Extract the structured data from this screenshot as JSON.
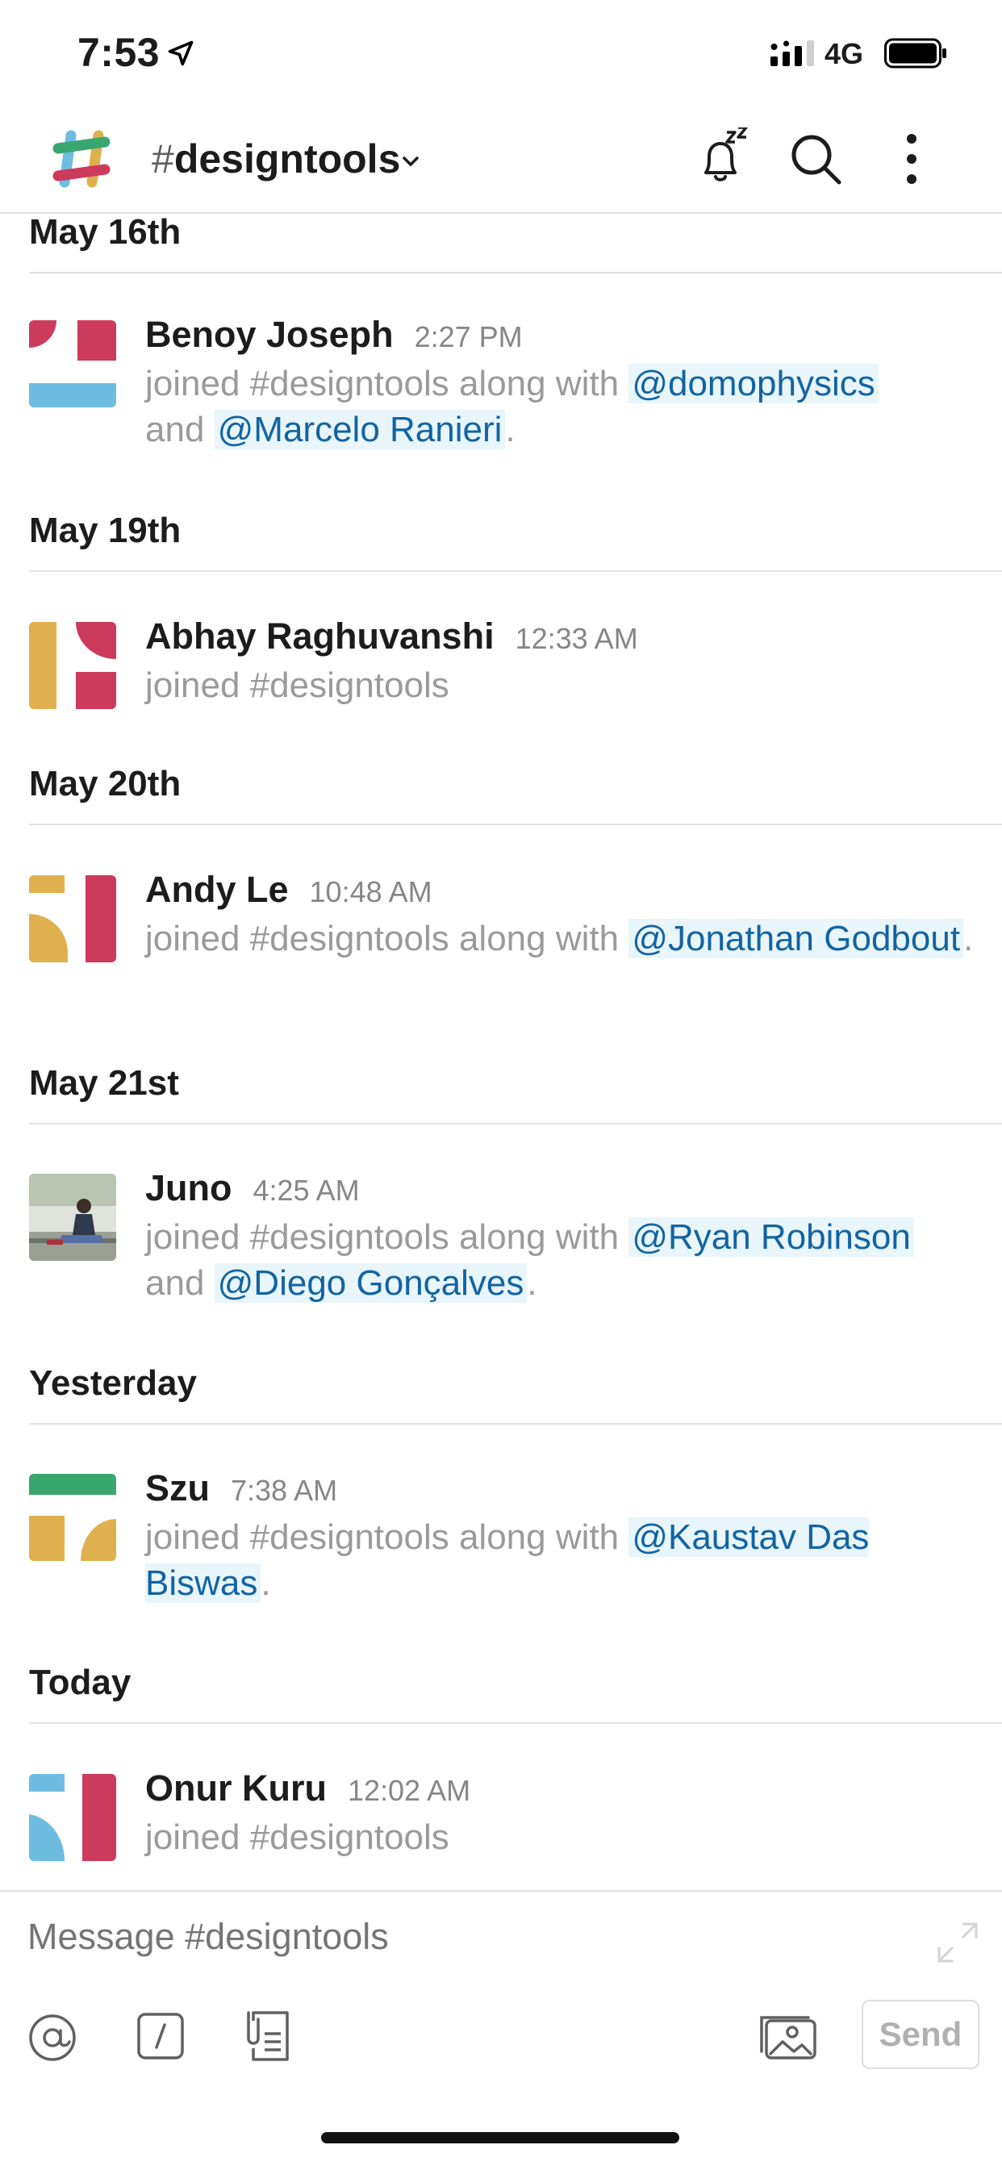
{
  "status_bar": {
    "time": "7:53",
    "network": "4G"
  },
  "header": {
    "hash": "#",
    "channel": "designtools"
  },
  "days": [
    {
      "label": "May 16th",
      "messages": [
        {
          "author": "Benoy Joseph",
          "time": "2:27 PM",
          "text_1": "joined #designtools along with ",
          "mention_1": "@domophysics",
          "text_2": "and ",
          "mention_2": "@Marcelo Ranieri",
          "text_3": "."
        }
      ]
    },
    {
      "label": "May 19th",
      "messages": [
        {
          "author": "Abhay Raghuvanshi",
          "time": "12:33 AM",
          "text_1": "joined #designtools"
        }
      ]
    },
    {
      "label": "May 20th",
      "messages": [
        {
          "author": "Andy Le",
          "time": "10:48 AM",
          "text_1": "joined #designtools along with ",
          "mention_1": "@Jonathan Godbout",
          "text_2": "."
        }
      ]
    },
    {
      "label": "May 21st",
      "messages": [
        {
          "author": "Juno",
          "time": "4:25 AM",
          "text_1": "joined #designtools along with ",
          "mention_1": "@Ryan Robinson",
          "text_2": "and ",
          "mention_2": "@Diego Gonçalves",
          "text_3": "."
        }
      ]
    },
    {
      "label": "Yesterday",
      "messages": [
        {
          "author": "Szu",
          "time": "7:38 AM",
          "text_1": "joined #designtools along with ",
          "mention_1": "@Kaustav Das Biswas",
          "text_2": "."
        }
      ]
    },
    {
      "label": "Today",
      "messages": [
        {
          "author": "Onur Kuru",
          "time": "12:02 AM",
          "text_1": "joined #designtools"
        }
      ]
    }
  ],
  "composer": {
    "placeholder": "Message #designtools",
    "send_label": "Send"
  },
  "colors": {
    "mention": "#1264a3",
    "mention_bg": "#e8f5fa",
    "red": "#cc3a5c",
    "blue": "#6ebde1",
    "gold": "#e0b04e",
    "green": "#3aa66f"
  },
  "icons": [
    "location-arrow-icon",
    "signal-icon",
    "battery-icon",
    "slack-logo-icon",
    "chevron-down-icon",
    "snooze-bell-icon",
    "search-icon",
    "more-vertical-icon",
    "expand-icon",
    "at-icon",
    "slash-command-icon",
    "attachment-icon",
    "photo-icon"
  ]
}
